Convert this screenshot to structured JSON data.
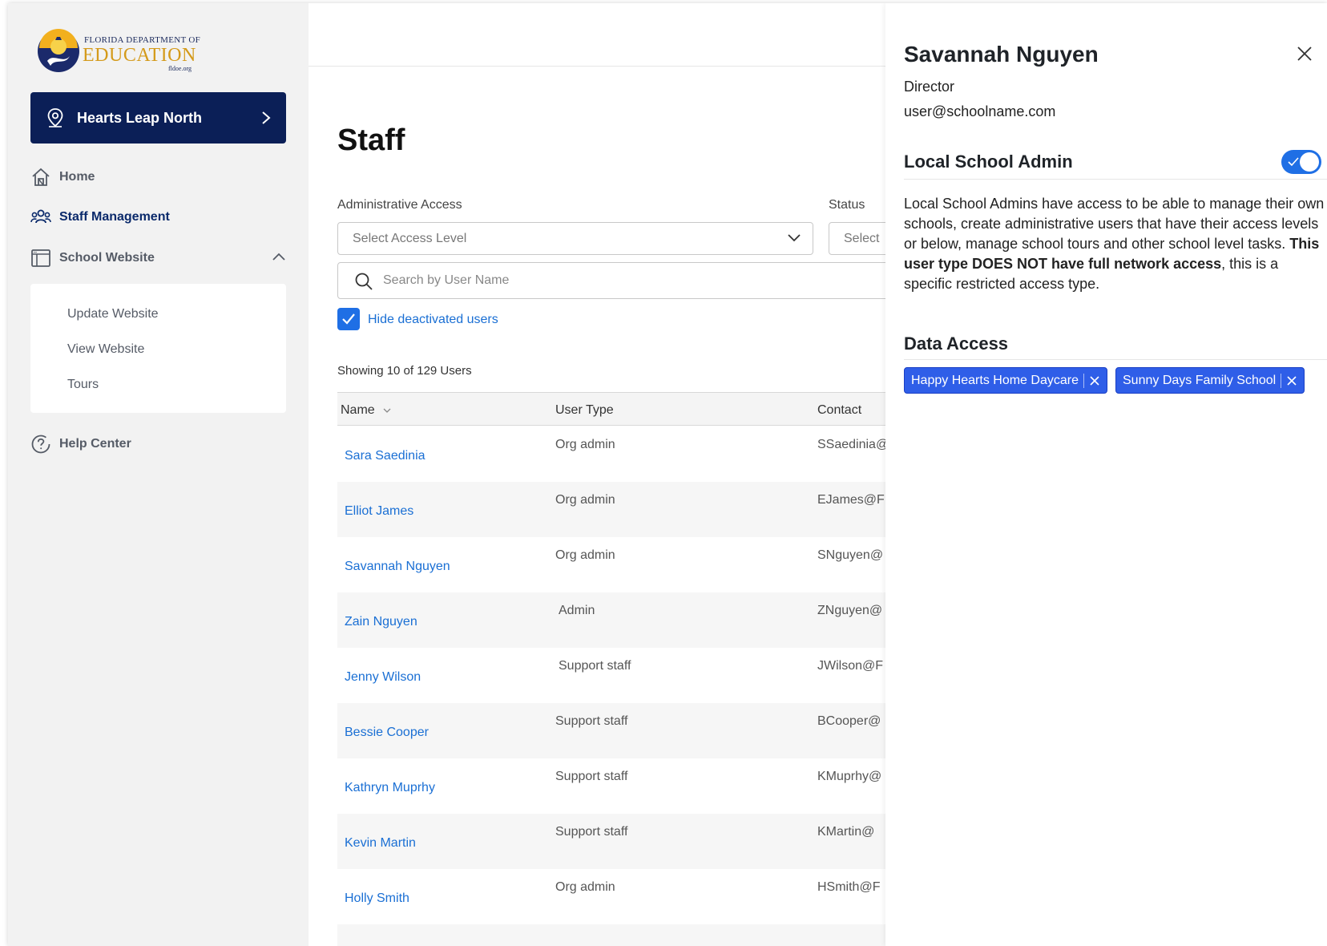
{
  "logo": {
    "line1": "FLORIDA DEPARTMENT OF",
    "line2": "EDUCATION",
    "line3": "fldoe.org"
  },
  "sidebar": {
    "school": "Hearts Leap North",
    "items": [
      {
        "label": "Home",
        "icon": "home-icon"
      },
      {
        "label": "Staff Management",
        "icon": "users-icon",
        "active": true
      },
      {
        "label": "School Website",
        "icon": "browser-window-icon",
        "expanded": true
      },
      {
        "label": "Help Center",
        "icon": "help-icon"
      }
    ],
    "website_sub": [
      "Update Website",
      "View Website",
      "Tours"
    ]
  },
  "main": {
    "title": "Staff",
    "filters": {
      "access_label": "Administrative Access",
      "access_placeholder": "Select Access Level",
      "status_label": "Status",
      "status_placeholder": "Select",
      "search_placeholder": "Search by User Name",
      "hide_deactivated_label": "Hide deactivated users",
      "hide_deactivated_checked": true
    },
    "showing": "Showing 10 of 129 Users",
    "table": {
      "columns": [
        "Name",
        "User Type",
        "Contact"
      ],
      "rows": [
        {
          "name": "Sara Saedinia",
          "type": "Org admin",
          "contact": "SSaedinia@"
        },
        {
          "name": "Elliot James",
          "type": "Org admin",
          "contact": "EJames@F"
        },
        {
          "name": "Savannah Nguyen",
          "type": "Org admin",
          "contact": "SNguyen@"
        },
        {
          "name": "Zain Nguyen",
          "type": "Admin",
          "contact": "ZNguyen@"
        },
        {
          "name": "Jenny Wilson",
          "type": "Support staff",
          "contact": "JWilson@F"
        },
        {
          "name": "Bessie Cooper",
          "type": "Support staff",
          "contact": "BCooper@"
        },
        {
          "name": "Kathryn Muprhy",
          "type": "Support staff",
          "contact": "KMuprhy@"
        },
        {
          "name": "Kevin Martin",
          "type": "Support staff",
          "contact": "KMartin@"
        },
        {
          "name": "Holly Smith",
          "type": "Org admin",
          "contact": "HSmith@F"
        }
      ]
    }
  },
  "drawer": {
    "name": "Savannah Nguyen",
    "role": "Director",
    "email": "user@schoolname.com",
    "admin_section": "Local School Admin",
    "admin_toggle_on": true,
    "desc_part1": "Local School Admins have access to be able to manage their own schools, create administrative users that have their access levels or below, manage school tours and other school level tasks. ",
    "desc_bold": "This user type DOES NOT have full network access",
    "desc_part2": ", this is a specific restricted access type.",
    "data_section": "Data Access",
    "chips": [
      "Happy Hearts Home Daycare",
      "Sunny Days Family School"
    ]
  },
  "colors": {
    "navy": "#0b1f57",
    "link_blue": "#1a6fd4",
    "accent_blue": "#1f6fe5",
    "chip_blue": "#2f5ee8"
  }
}
